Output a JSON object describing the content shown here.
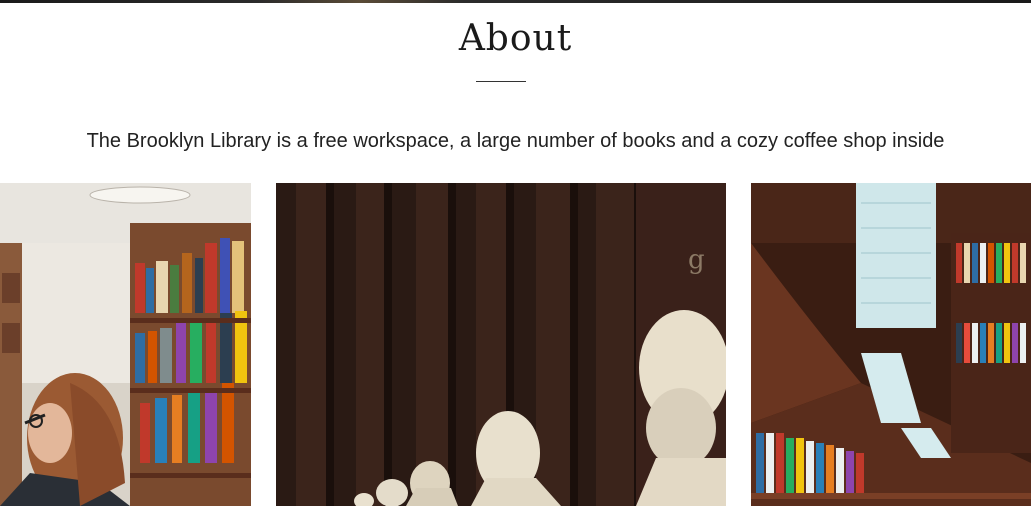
{
  "about": {
    "title": "About",
    "description": "The Brooklyn Library is a free workspace, a large number of books and a cozy coffee shop inside"
  },
  "gallery": {
    "images": [
      {
        "subject": "woman-browsing-library-shelves"
      },
      {
        "subject": "marble-busts-in-library-hall"
      },
      {
        "subject": "curved-library-bookshelves-with-lights"
      }
    ]
  },
  "colors": {
    "text": "#1a1a1a",
    "background": "#ffffff",
    "wood": "#5a2d1c"
  }
}
